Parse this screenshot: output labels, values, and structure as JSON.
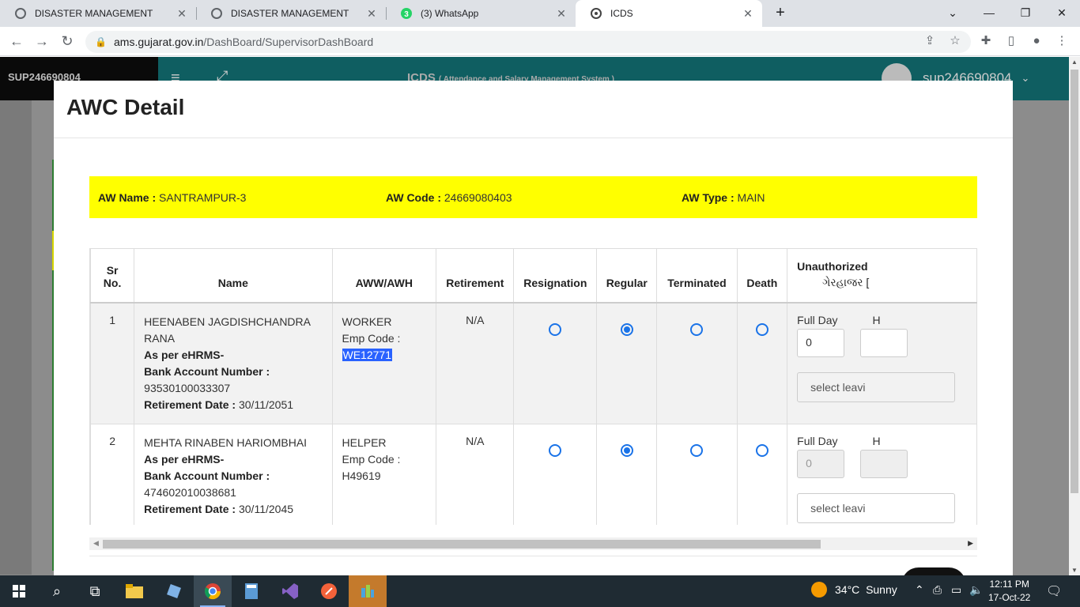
{
  "browser": {
    "tabs": [
      {
        "title": "DISASTER MANAGEMENT",
        "active": false
      },
      {
        "title": "DISASTER MANAGEMENT",
        "active": false
      },
      {
        "title": "(3) WhatsApp",
        "active": false,
        "badge": "3"
      },
      {
        "title": "ICDS",
        "active": true
      }
    ],
    "url_host": "ams.gujarat.gov.in",
    "url_path": "/DashBoard/SupervisorDashBoard"
  },
  "app": {
    "user_id_left": "SUP246690804",
    "title": "ICDS",
    "subtitle": "( Attendance and Salary Management System )",
    "username": "sup246690804"
  },
  "modal": {
    "title": "AWC Detail",
    "aw_name_label": "AW Name :",
    "aw_name": "SANTRAMPUR-3",
    "aw_code_label": "AW Code :",
    "aw_code": "24669080403",
    "aw_type_label": "AW Type :",
    "aw_type": "MAIN",
    "columns": [
      "Sr No.",
      "Name",
      "AWW/AWH",
      "Retirement",
      "Resignation",
      "Regular",
      "Terminated",
      "Death",
      "Unauthorized",
      "ગેરહાજર ["
    ],
    "rows": [
      {
        "sr": "1",
        "name": "HEENABEN JAGDISHCHANDRA RANA",
        "ehrms_label": "As per eHRMS-",
        "bank_label": "Bank Account Number :",
        "bank": "93530100033307",
        "ret_label": "Retirement Date :",
        "ret_date": "30/11/2051",
        "role": "WORKER",
        "emp_label": "Emp Code :",
        "emp_code": "WE12771",
        "retirement": "N/A",
        "full_day_label": "Full Day",
        "half_label": "H",
        "full_day_value": "0",
        "select_placeholder": "select leavi"
      },
      {
        "sr": "2",
        "name": "MEHTA RINABEN HARIOMBHAI",
        "ehrms_label": "As per eHRMS-",
        "bank_label": "Bank Account Number :",
        "bank": "474602010038681",
        "ret_label": "Retirement Date :",
        "ret_date": "30/11/2045",
        "role": "HELPER",
        "emp_label": "Emp Code :",
        "emp_code": "H49619",
        "retirement": "N/A",
        "full_day_label": "Full Day",
        "half_label": "H",
        "full_day_value": "0",
        "select_placeholder": "select leavi"
      }
    ]
  },
  "taskbar": {
    "weather_temp": "34°C",
    "weather_text": "Sunny",
    "time": "12:11 PM",
    "date": "17-Oct-22"
  },
  "colors": {
    "accent": "#1a73e8",
    "info_bar": "#ffff00",
    "header_teal": "#0f5e61"
  }
}
